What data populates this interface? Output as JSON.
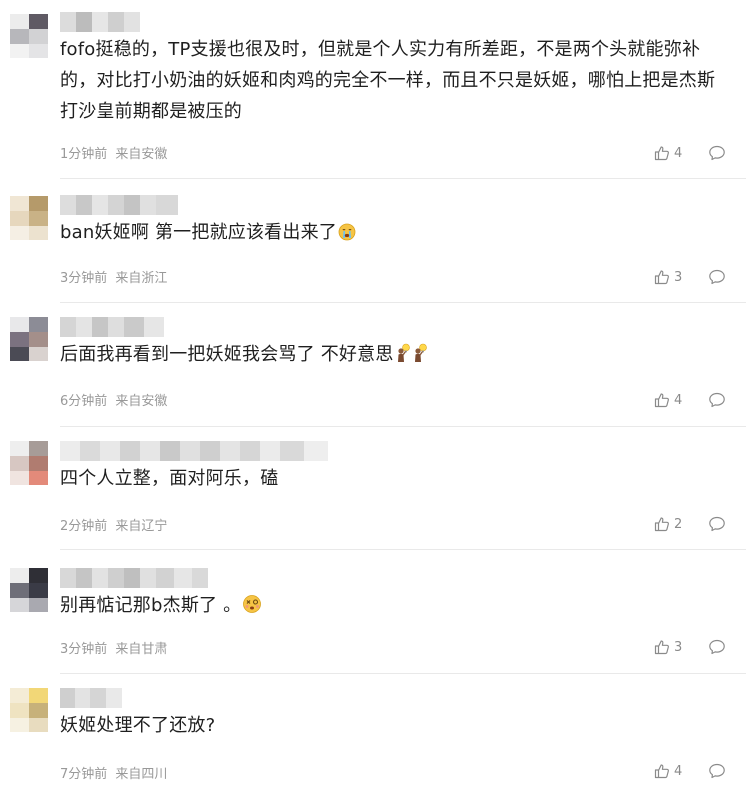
{
  "comments": [
    {
      "text": "fofo挺稳的，TP支援也很及时，但就是个人实力有所差距，不是两个头就能弥补的，对比打小奶油的妖姬和肉鸡的完全不一样，而且不只是妖姬，哪怕上把是杰斯打沙皇前期都是被压的",
      "time": "1分钟前",
      "location": "来自安徽",
      "likes": "4",
      "emojis": []
    },
    {
      "text": "ban妖姬啊 第一把就应该看出来了",
      "time": "3分钟前",
      "location": "来自浙江",
      "likes": "3",
      "emojis": [
        "crying-face-emoji"
      ]
    },
    {
      "text": "后面我再看到一把妖姬我会骂了 不好意思",
      "time": "6分钟前",
      "location": "来自安徽",
      "likes": "4",
      "emojis": [
        "lightbulb-person-emoji",
        "lightbulb-person-emoji"
      ]
    },
    {
      "text": "四个人立整，面对阿乐，磕",
      "time": "2分钟前",
      "location": "来自辽宁",
      "likes": "2",
      "emojis": []
    },
    {
      "text": "别再惦记那b杰斯了 。",
      "time": "3分钟前",
      "location": "来自甘肃",
      "likes": "3",
      "emojis": [
        "dizzy-face-emoji"
      ]
    },
    {
      "text": "妖姬处理不了还放?",
      "time": "7分钟前",
      "location": "来自四川",
      "likes": "4",
      "emojis": []
    }
  ],
  "colors": {
    "text": "#1f1f1f",
    "meta": "#999999",
    "icon": "#8a8a8a",
    "divider": "#e9e9e9"
  }
}
